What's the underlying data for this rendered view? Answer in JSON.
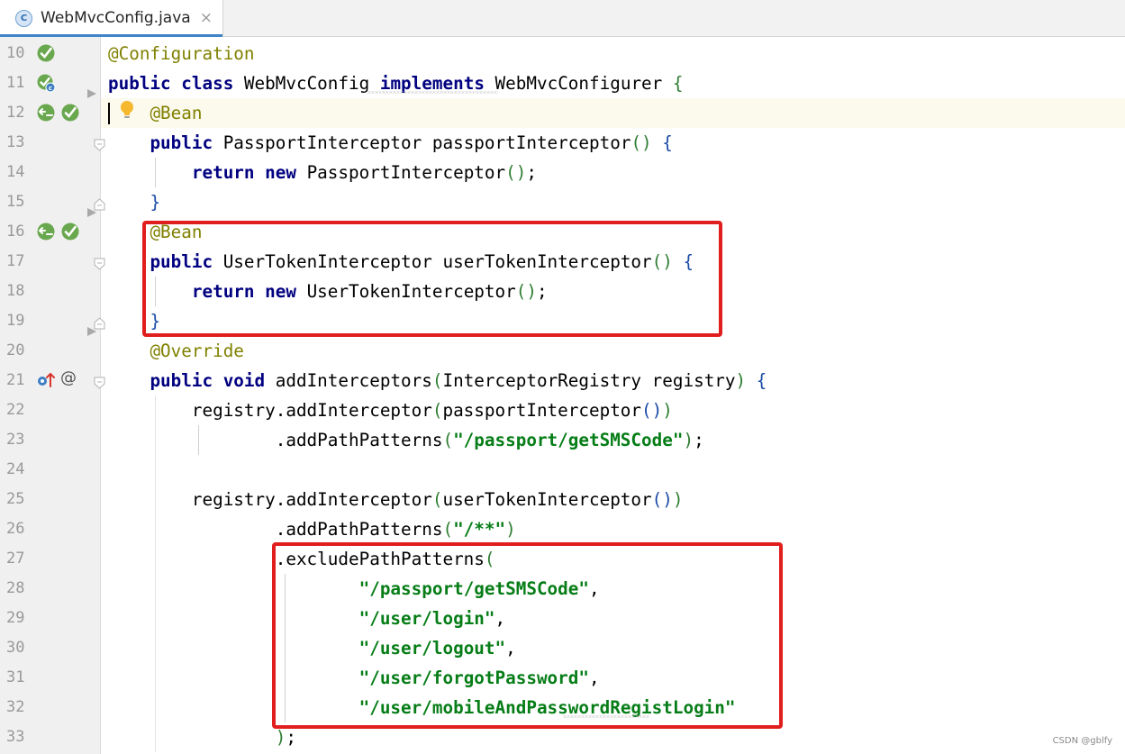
{
  "tab": {
    "file_icon_letter": "C",
    "title": "WebMvcConfig.java",
    "close_glyph": "×",
    "accent_color": "#4083c9"
  },
  "gutter": {
    "line_numbers": [
      "10",
      "11",
      "12",
      "13",
      "14",
      "15",
      "16",
      "17",
      "18",
      "19",
      "20",
      "21",
      "22",
      "23",
      "24",
      "25",
      "26",
      "27",
      "28",
      "29",
      "30",
      "31",
      "32",
      "33"
    ],
    "icons": {
      "10": [
        "spring-bean-icon"
      ],
      "11": [
        "spring-config-icon"
      ],
      "12": [
        "spring-inject-icon",
        "spring-bean-icon"
      ],
      "16": [
        "spring-inject-icon",
        "spring-bean-icon"
      ],
      "21": [
        "override-up-icon",
        "at-annotation-icon"
      ]
    },
    "at_glyph": "@"
  },
  "code": [
    [
      {
        "t": "@Configuration",
        "c": "ann"
      }
    ],
    [
      {
        "t": "public",
        "c": "kw"
      },
      {
        "t": " "
      },
      {
        "t": "class",
        "c": "kw"
      },
      {
        "t": " WebMvcConfig "
      },
      {
        "t": "implements",
        "c": "kw"
      },
      {
        "t": " WebMvcConfigurer "
      },
      {
        "t": "{",
        "c": "p1"
      }
    ],
    [
      {
        "t": "    "
      },
      {
        "t": "@Bean",
        "c": "ann"
      }
    ],
    [
      {
        "t": "    "
      },
      {
        "t": "public",
        "c": "kw"
      },
      {
        "t": " PassportInterceptor passportInterceptor"
      },
      {
        "t": "()",
        "c": "p1"
      },
      {
        "t": " "
      },
      {
        "t": "{",
        "c": "p2"
      }
    ],
    [
      {
        "t": "        "
      },
      {
        "t": "return",
        "c": "kw"
      },
      {
        "t": " "
      },
      {
        "t": "new",
        "c": "kw"
      },
      {
        "t": " PassportInterceptor"
      },
      {
        "t": "()",
        "c": "p1"
      },
      {
        "t": ";"
      }
    ],
    [
      {
        "t": "    "
      },
      {
        "t": "}",
        "c": "p2"
      }
    ],
    [
      {
        "t": "    "
      },
      {
        "t": "@Bean",
        "c": "ann"
      }
    ],
    [
      {
        "t": "    "
      },
      {
        "t": "public",
        "c": "kw"
      },
      {
        "t": " UserTokenInterceptor userTokenInterceptor"
      },
      {
        "t": "()",
        "c": "p1"
      },
      {
        "t": " "
      },
      {
        "t": "{",
        "c": "p2"
      }
    ],
    [
      {
        "t": "        "
      },
      {
        "t": "return",
        "c": "kw"
      },
      {
        "t": " "
      },
      {
        "t": "new",
        "c": "kw"
      },
      {
        "t": " UserTokenInterceptor"
      },
      {
        "t": "()",
        "c": "p1"
      },
      {
        "t": ";"
      }
    ],
    [
      {
        "t": "    "
      },
      {
        "t": "}",
        "c": "p2"
      }
    ],
    [
      {
        "t": "    "
      },
      {
        "t": "@Override",
        "c": "ann"
      }
    ],
    [
      {
        "t": "    "
      },
      {
        "t": "public",
        "c": "kw"
      },
      {
        "t": " "
      },
      {
        "t": "void",
        "c": "kw"
      },
      {
        "t": " addInterceptors"
      },
      {
        "t": "(",
        "c": "p1"
      },
      {
        "t": "InterceptorRegistry registry"
      },
      {
        "t": ")",
        "c": "p1"
      },
      {
        "t": " "
      },
      {
        "t": "{",
        "c": "p2"
      }
    ],
    [
      {
        "t": "        registry.addInterceptor"
      },
      {
        "t": "(",
        "c": "p1"
      },
      {
        "t": "passportInterceptor"
      },
      {
        "t": "()",
        "c": "p2"
      },
      {
        "t": ")",
        "c": "p1"
      }
    ],
    [
      {
        "t": "                .addPathPatterns"
      },
      {
        "t": "(",
        "c": "p1"
      },
      {
        "t": "\"/passport/getSMSCode\"",
        "c": "str"
      },
      {
        "t": ")",
        "c": "p1"
      },
      {
        "t": ";"
      }
    ],
    [
      {
        "t": ""
      }
    ],
    [
      {
        "t": "        registry.addInterceptor"
      },
      {
        "t": "(",
        "c": "p1"
      },
      {
        "t": "userTokenInterceptor"
      },
      {
        "t": "()",
        "c": "p2"
      },
      {
        "t": ")",
        "c": "p1"
      }
    ],
    [
      {
        "t": "                .addPathPatterns"
      },
      {
        "t": "(",
        "c": "p1"
      },
      {
        "t": "\"/**\"",
        "c": "str"
      },
      {
        "t": ")",
        "c": "p1"
      }
    ],
    [
      {
        "t": "                .excludePathPatterns"
      },
      {
        "t": "(",
        "c": "p1"
      }
    ],
    [
      {
        "t": "                        "
      },
      {
        "t": "\"/passport/getSMSCode\"",
        "c": "str"
      },
      {
        "t": ","
      }
    ],
    [
      {
        "t": "                        "
      },
      {
        "t": "\"/user/login\"",
        "c": "str"
      },
      {
        "t": ","
      }
    ],
    [
      {
        "t": "                        "
      },
      {
        "t": "\"/user/logout\"",
        "c": "str"
      },
      {
        "t": ","
      }
    ],
    [
      {
        "t": "                        "
      },
      {
        "t": "\"/user/forgotPassword\"",
        "c": "str"
      },
      {
        "t": ","
      }
    ],
    [
      {
        "t": "                        "
      },
      {
        "t": "\"/user/mobileAndPasswordRegistLogin\"",
        "c": "str"
      }
    ],
    [
      {
        "t": "                "
      },
      {
        "t": ")",
        "c": "p1"
      },
      {
        "t": ";"
      }
    ]
  ],
  "watermark": "CSDN @gblfy",
  "colors": {
    "highlight_box": "#e11e1e",
    "keyword": "#000080",
    "annotation": "#808000",
    "string": "#067d17"
  }
}
